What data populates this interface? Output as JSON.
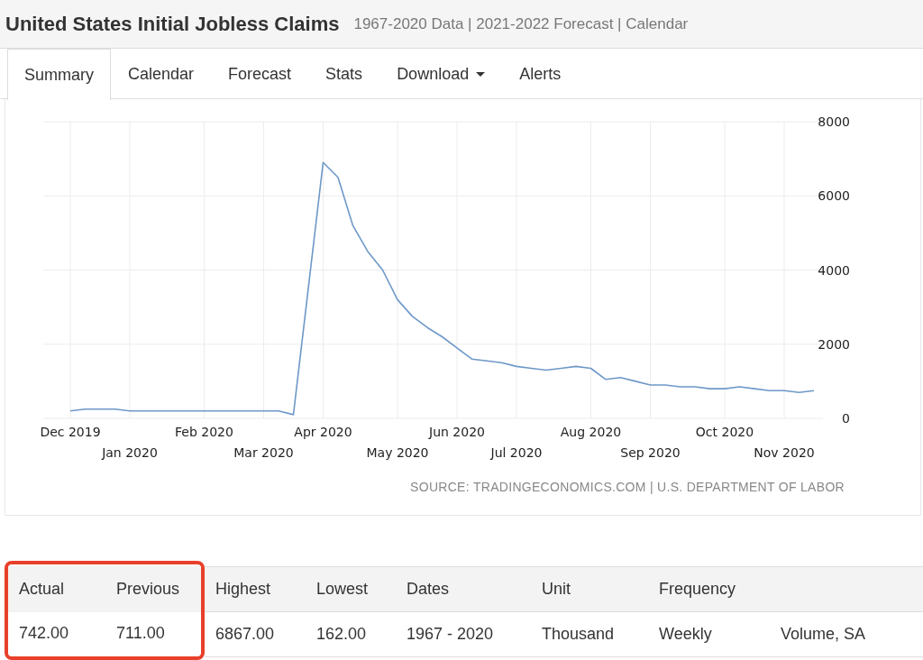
{
  "header": {
    "title": "United States Initial Jobless Claims",
    "subtitle": "1967-2020 Data | 2021-2022 Forecast | Calendar"
  },
  "tabs": [
    {
      "label": "Summary",
      "selected": true,
      "dropdown": false
    },
    {
      "label": "Calendar",
      "selected": false,
      "dropdown": false
    },
    {
      "label": "Forecast",
      "selected": false,
      "dropdown": false
    },
    {
      "label": "Stats",
      "selected": false,
      "dropdown": false
    },
    {
      "label": "Download",
      "selected": false,
      "dropdown": true
    },
    {
      "label": "Alerts",
      "selected": false,
      "dropdown": false
    }
  ],
  "chart": {
    "chart_data": {
      "type": "line",
      "categories": [
        "Dec 2019",
        null,
        null,
        null,
        "Jan 2020",
        null,
        null,
        null,
        null,
        "Feb 2020",
        null,
        null,
        null,
        "Mar 2020",
        null,
        null,
        null,
        "Apr 2020",
        null,
        null,
        null,
        null,
        "May 2020",
        null,
        null,
        null,
        "Jun 2020",
        null,
        null,
        null,
        "Jul 2020",
        null,
        null,
        null,
        null,
        "Aug 2020",
        null,
        null,
        null,
        "Sep 2020",
        null,
        null,
        null,
        null,
        "Oct 2020",
        null,
        null,
        null,
        "Nov 2020",
        null,
        null
      ],
      "series": [
        {
          "color": "#6e98c8",
          "values": [
            200,
            250,
            250,
            250,
            200,
            200,
            200,
            200,
            200,
            200,
            200,
            200,
            200,
            200,
            200,
            100,
            3500,
            6900,
            6500,
            5200,
            4500,
            4000,
            3200,
            2750,
            2450,
            2200,
            1900,
            1600,
            1550,
            1500,
            1400,
            1350,
            1300,
            1350,
            1400,
            1350,
            1050,
            1100,
            1000,
            900,
            900,
            850,
            850,
            800,
            800,
            850,
            800,
            750,
            750,
            700,
            750
          ]
        }
      ],
      "ylim": [
        0,
        8000
      ],
      "grid": true,
      "yticks": [
        0,
        2000,
        4000,
        6000,
        8000
      ]
    },
    "source": "SOURCE: TRADINGECONOMICS.COM | U.S. DEPARTMENT OF LABOR"
  },
  "table": {
    "columns": [
      {
        "header": "Actual",
        "value": "742.00",
        "highlighted": true
      },
      {
        "header": "Previous",
        "value": "711.00",
        "highlighted": true
      },
      {
        "header": "Highest",
        "value": "6867.00",
        "highlighted": false
      },
      {
        "header": "Lowest",
        "value": "162.00",
        "highlighted": false
      },
      {
        "header": "Dates",
        "value": "1967 - 2020",
        "highlighted": false
      },
      {
        "header": "Unit",
        "value": "Thousand",
        "highlighted": false
      },
      {
        "header": "Frequency",
        "value": "Weekly",
        "highlighted": false
      },
      {
        "value": "Volume, SA",
        "highlighted": false
      }
    ]
  }
}
